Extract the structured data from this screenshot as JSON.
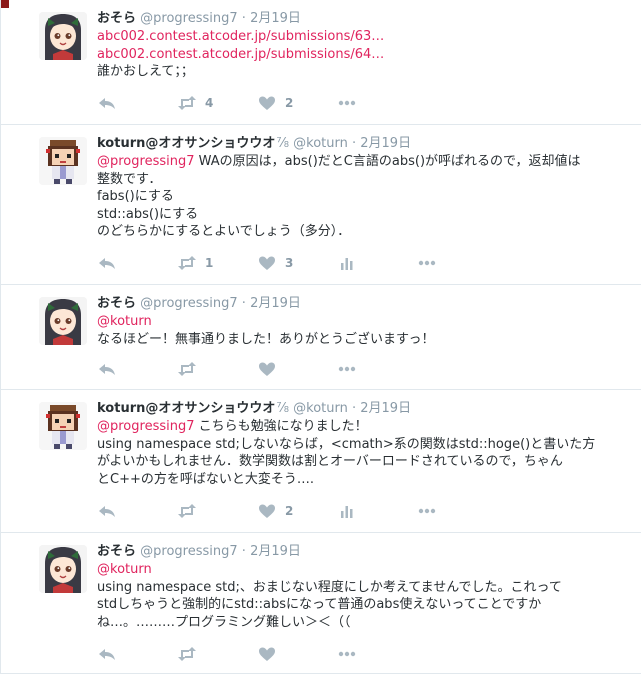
{
  "tweets": [
    {
      "avatar": "girl-avatar",
      "fullname": "おそら",
      "screenname": "@progressing7",
      "sep": "·",
      "time": "2月19日",
      "lines": [
        {
          "text": "abc002.contest.atcoder.jp/submissions/63…",
          "type": "link"
        },
        {
          "text": "abc002.contest.atcoder.jp/submissions/64…",
          "type": "link"
        },
        {
          "text": "誰かおしえて；；",
          "type": "text"
        }
      ],
      "retweets": "4",
      "likes": "2"
    },
    {
      "avatar": "character-avatar",
      "fullname": "koturn@オオサンショウウオ",
      "badge": "⅞",
      "screenname": "@koturn",
      "sep": "·",
      "time": "2月19日",
      "lines": [
        {
          "mention": "@progressing7",
          "text": " WAの原因は，abs()だとC言語のabs()が呼ばれるので，返却値は"
        },
        {
          "text": "整数です．"
        },
        {
          "text": "fabs()にする"
        },
        {
          "text": "std::abs()にする"
        },
        {
          "text": "のどちらかにするとよいでしょう（多分）．"
        }
      ],
      "retweets": "1",
      "likes": "3"
    },
    {
      "avatar": "girl-avatar",
      "fullname": "おそら",
      "screenname": "@progressing7",
      "sep": "·",
      "time": "2月19日",
      "lines": [
        {
          "mention": "@koturn",
          "text": ""
        },
        {
          "text": "なるほどー！無事通りました！ありがとうございますっ！"
        }
      ],
      "retweets": "",
      "likes": ""
    },
    {
      "avatar": "character-avatar",
      "fullname": "koturn@オオサンショウウオ",
      "badge": "⅞",
      "screenname": "@koturn",
      "sep": "·",
      "time": "2月19日",
      "lines": [
        {
          "mention": "@progressing7",
          "text": " こちらも勉強になりました！"
        },
        {
          "text": "using namespace std;しないならば，<cmath>系の関数はstd::hoge()と書いた方"
        },
        {
          "text": "がよいかもしれません．数学関数は割とオーバーロードされているので，ちゃん"
        },
        {
          "text": "とC++の方を呼ばないと大変そう…."
        }
      ],
      "retweets": "",
      "likes": "2"
    },
    {
      "avatar": "girl-avatar",
      "fullname": "おそら",
      "screenname": "@progressing7",
      "sep": "·",
      "time": "2月19日",
      "lines": [
        {
          "mention": "@koturn",
          "text": ""
        },
        {
          "text": "using namespace std;、おまじない程度にしか考えてませんでした。これって"
        },
        {
          "text": "stdしちゃうと強制的にstd::absになって普通のabs使えないってことですか"
        },
        {
          "text": "ね…。………プログラミング難しい＞＜（（"
        }
      ],
      "retweets": "",
      "likes": ""
    }
  ],
  "icons": {
    "reply": "reply-icon",
    "retweet": "retweet-icon",
    "like": "heart-icon",
    "analytics": "analytics-icon",
    "more": "more-icon"
  },
  "colors": {
    "link": "#e0245e",
    "muted": "#8899a6",
    "icon": "#aab8c2",
    "border": "#e1e8ed"
  }
}
